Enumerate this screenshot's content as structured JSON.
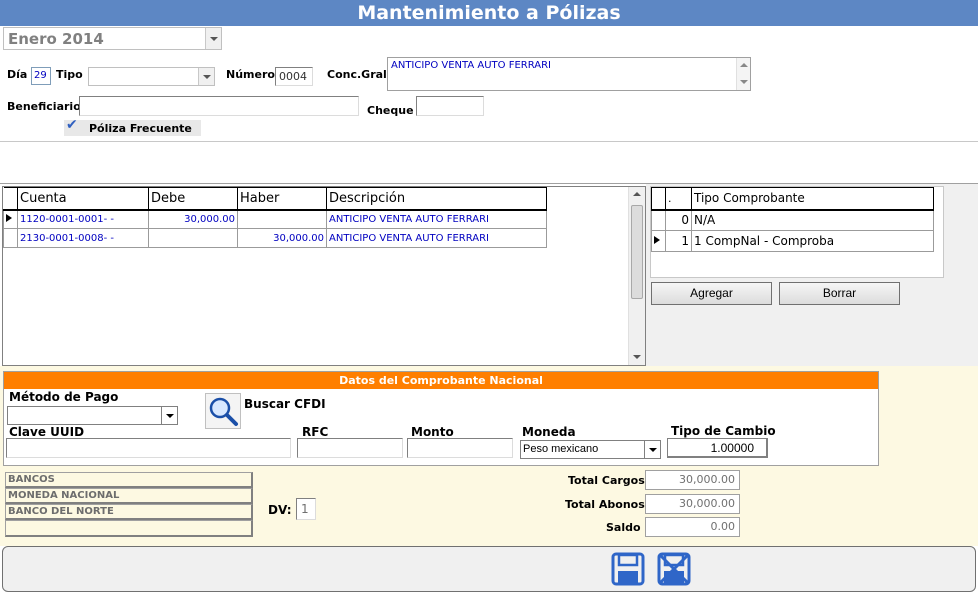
{
  "title": "Mantenimiento a Pólizas",
  "period": {
    "value": "Enero 2014"
  },
  "header": {
    "dia_label": "Día",
    "dia_value": "29",
    "tipo_label": "Tipo",
    "tipo_value": "",
    "numero_label": "Número",
    "numero_value": "0004",
    "concgral_label": "Conc.Gral",
    "concgral_value": "ANTICIPO VENTA AUTO FERRARI",
    "beneficiario_label": "Beneficiario",
    "beneficiario_value": "",
    "cheque_label": "Cheque",
    "cheque_value": "",
    "frecuente_label": "Póliza Frecuente"
  },
  "entries": {
    "columns": [
      "Cuenta",
      "Debe",
      "Haber",
      "Descripción"
    ],
    "rows": [
      {
        "cuenta": "1120-0001-0001-   -",
        "debe": "30,000.00",
        "haber": "",
        "descripcion": "ANTICIPO VENTA AUTO FERRARI"
      },
      {
        "cuenta": "2130-0001-0008-   -",
        "debe": "",
        "haber": "30,000.00",
        "descripcion": "ANTICIPO VENTA AUTO FERRARI"
      }
    ]
  },
  "comprobantes": {
    "columns": [
      ".",
      "Tipo Comprobante"
    ],
    "rows": [
      {
        "num": "0",
        "tipo": "N/A"
      },
      {
        "num": "1",
        "tipo": "1 CompNal - Comproba"
      }
    ],
    "add_label": "Agregar",
    "delete_label": "Borrar"
  },
  "nacional": {
    "header": "Datos del Comprobante Nacional",
    "metodo_label": "Método de Pago",
    "metodo_value": "",
    "buscar_label": "Buscar CFDI",
    "uuid_label": "Clave UUID",
    "uuid_value": "",
    "rfc_label": "RFC",
    "rfc_value": "",
    "monto_label": "Monto",
    "monto_value": "",
    "moneda_label": "Moneda",
    "moneda_value": "Peso mexicano",
    "tc_label": "Tipo de Cambio",
    "tc_value": "1.00000"
  },
  "bank": {
    "lines": [
      "BANCOS",
      "MONEDA NACIONAL",
      "BANCO DEL NORTE",
      ""
    ],
    "dv_label": "DV:",
    "dv_value": "1"
  },
  "totals": {
    "cargos_label": "Total Cargos",
    "cargos_value": "30,000.00",
    "abonos_label": "Total Abonos",
    "abonos_value": "30,000.00",
    "saldo_label": "Saldo",
    "saldo_value": "0.00"
  },
  "colors": {
    "title_bg": "#5d87c4",
    "section_orange": "#ff7f00",
    "form_bg": "#fdf9e2",
    "link_blue": "#0000c0"
  },
  "icons": {
    "save": "save-icon",
    "cancel": "cancel-save-icon",
    "search": "magnifier-icon"
  }
}
